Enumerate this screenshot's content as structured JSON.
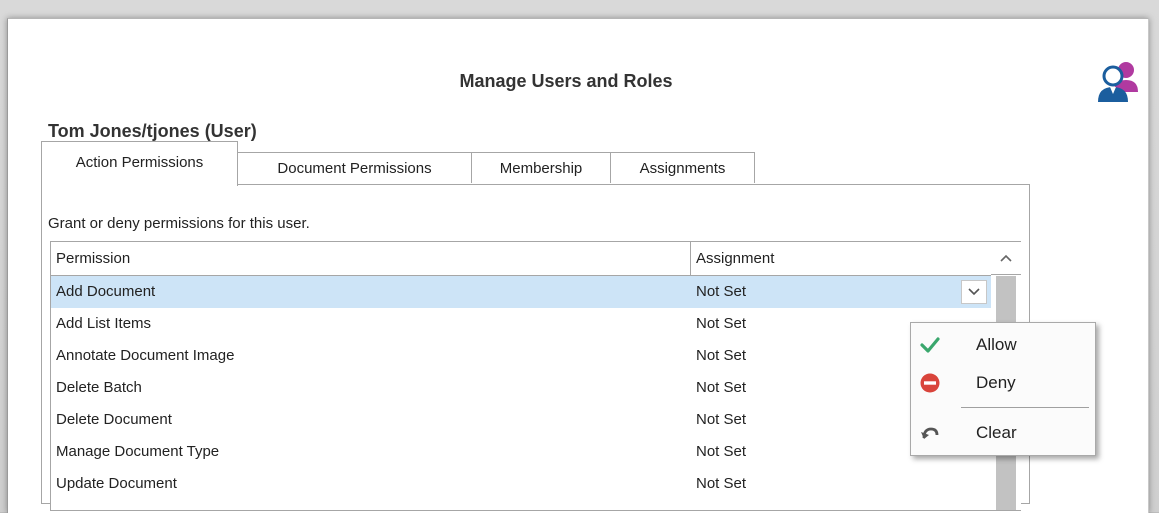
{
  "dialog": {
    "title": "Manage Users and Roles",
    "user_heading": "Tom Jones/tjones (User)",
    "icon": "users-icon"
  },
  "tabs": [
    {
      "label": "Action Permissions",
      "active": true
    },
    {
      "label": "Document Permissions",
      "active": false
    },
    {
      "label": "Membership",
      "active": false
    },
    {
      "label": "Assignments",
      "active": false
    }
  ],
  "hint": "Grant or deny permissions for this user.",
  "grid": {
    "columns": [
      "Permission",
      "Assignment"
    ],
    "rows": [
      {
        "permission": "Add Document",
        "assignment": "Not Set",
        "selected": true
      },
      {
        "permission": "Add List Items",
        "assignment": "Not Set"
      },
      {
        "permission": "Annotate Document Image",
        "assignment": "Not Set"
      },
      {
        "permission": "Delete Batch",
        "assignment": "Not Set"
      },
      {
        "permission": "Delete Document",
        "assignment": "Not Set"
      },
      {
        "permission": "Manage Document Type",
        "assignment": "Not Set"
      },
      {
        "permission": "Update Document",
        "assignment": "Not Set"
      }
    ]
  },
  "dropdown_menu": {
    "items": [
      {
        "label": "Allow",
        "icon": "check-icon",
        "color": "#3aa76d"
      },
      {
        "label": "Deny",
        "icon": "deny-icon",
        "color": "#d9443b"
      },
      {
        "label": "Clear",
        "icon": "undo-icon",
        "color": "#555555"
      }
    ]
  }
}
